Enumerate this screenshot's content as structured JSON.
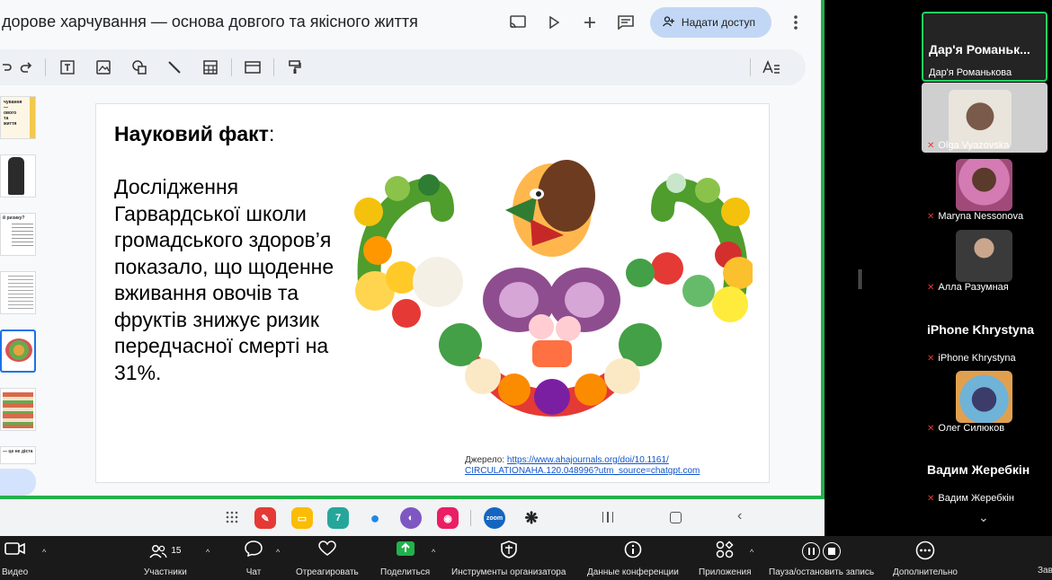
{
  "doc": {
    "title": "доровe харчування — основа довгого та якісного життя",
    "share_label": "Надати доступ"
  },
  "slide": {
    "title_bold": "Науковий факт",
    "title_rest": ":",
    "body": "Дослідження Гарвардської школи громадського здоров’я показало, що щоденне вживання овочів та фруктів знижує ризик передчасної смерті на 31%.",
    "source_label": "Джерело: ",
    "source_link_1": "https://www.ahajournals.org/doi/10.1161/",
    "source_link_2": "CIRCULATIONAHA.120.048996?utm_source=chatgpt.com"
  },
  "thumbs": [
    {
      "text": "чування — ового та життя"
    },
    {
      "text": ""
    },
    {
      "text": "й ризику?"
    },
    {
      "text": ""
    },
    {
      "text": ""
    },
    {
      "text": ""
    },
    {
      "text": "— це не дієта"
    }
  ],
  "participants": [
    {
      "name": "Дар'я Романькова",
      "big": "Дар'я Романьк...",
      "muted": false,
      "active": true
    },
    {
      "name": "Olga Vyazovska",
      "muted": true
    },
    {
      "name": "Maryna Nessonova",
      "muted": true
    },
    {
      "name": "Алла Разумная",
      "muted": true
    },
    {
      "name": "iPhone Khrystyna",
      "big": "iPhone Khrystyna",
      "muted": true
    },
    {
      "name": "Олег Силюков",
      "muted": true
    },
    {
      "name": "Вадим Жеребкін",
      "big": "Вадим Жеребкін",
      "muted": true
    }
  ],
  "zoom_toolbar": {
    "video": "Видео",
    "participants": "Участники",
    "participants_count": "15",
    "chat": "Чат",
    "react": "Отреагировать",
    "share": "Поделиться",
    "host_tools": "Инструменты организатора",
    "meeting_info": "Данные конференции",
    "apps": "Приложения",
    "record": "Пауза/остановить запись",
    "more": "Дополнительно",
    "end": "Зав"
  },
  "colors": {
    "share_border": "#22b14c",
    "share_btn": "#c2d7f5",
    "active_tile": "#23d160",
    "zoom_bg": "#1a1a1a"
  }
}
